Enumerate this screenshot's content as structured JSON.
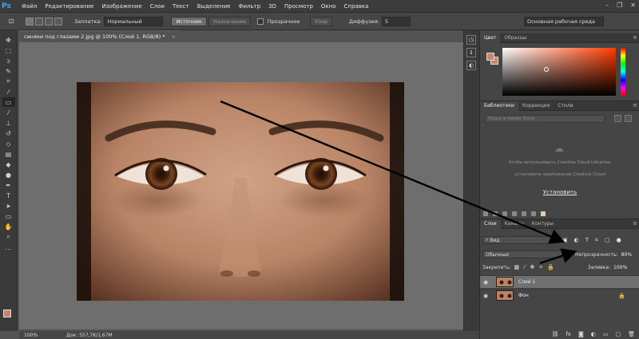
{
  "app": {
    "logo": "Ps",
    "menu": [
      "Файл",
      "Редактирование",
      "Изображение",
      "Слои",
      "Текст",
      "Выделение",
      "Фильтр",
      "3D",
      "Просмотр",
      "Окно",
      "Справка"
    ],
    "window_controls": [
      "–",
      "❐",
      "✕"
    ]
  },
  "options": {
    "fill_label": "Заплатка:",
    "fill_value": "Нормальный",
    "source_label": "Источник",
    "dest_label": "Назначение",
    "transparent_label": "Прозрачное",
    "pattern_label": "Узор",
    "diffusion_label": "Диффузия:",
    "diffusion_value": "5",
    "workspace": "Основная рабочая среда"
  },
  "document": {
    "tab_title": "синяки под глазами 2.jpg @ 100% (Слой 1, RGB/8) *",
    "close": "×",
    "zoom": "100%",
    "doc_size": "Док: 557,7K/1,67M"
  },
  "color_panel": {
    "tabs": [
      "Цвет",
      "Образцы"
    ],
    "fg": "#c9846d"
  },
  "libraries_panel": {
    "tabs": [
      "Библиотеки",
      "Коррекция",
      "Стили"
    ],
    "search_placeholder": "Поиск в Adobe Stock",
    "msg_line1": "Чтобы использовать Creative Cloud Libraries,",
    "msg_line2": "установите приложение Creative Cloud",
    "install_link": "Установить"
  },
  "layers_panel": {
    "tabs": [
      "Слои",
      "Каналы",
      "Контуры"
    ],
    "filter_value": "Вид",
    "blend_value": "Обычные",
    "opacity_label": "Непрозрачность:",
    "opacity_value": "80%",
    "lock_label": "Закрепить:",
    "fill_label": "Заливка:",
    "fill_value": "100%",
    "layers": [
      {
        "name": "Слой 1",
        "selected": true
      },
      {
        "name": "Фон",
        "selected": false
      }
    ]
  }
}
